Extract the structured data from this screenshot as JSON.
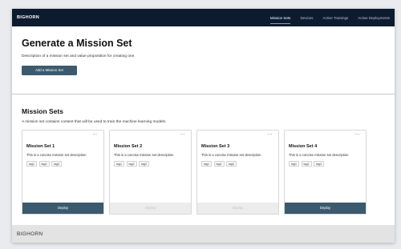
{
  "nav": {
    "brand": "BIGHORN",
    "links": [
      "Mission Sets",
      "Devices",
      "Active Trainings",
      "Active Deployments"
    ]
  },
  "hero": {
    "title": "Generate a Mission Set",
    "description": "Description of a mission set and value proposition for creating one.",
    "button_label": "Add a Mission Set"
  },
  "sets": {
    "title": "Mission Sets",
    "description": "A mission set contains content that will be used to train the machine learning models.",
    "cards": [
      {
        "title": "Mission Set 1",
        "description": "This is a concise mission set description",
        "tags": [
          "tag1",
          "tag2",
          "tag3"
        ],
        "menu": "...",
        "deploy_label": "Deploy",
        "deploy_enabled": true
      },
      {
        "title": "Mission Set 2",
        "description": "This is a concise mission set description",
        "tags": [
          "tag1",
          "tag2",
          "tag3"
        ],
        "menu": "...",
        "deploy_label": "Deploy",
        "deploy_enabled": false
      },
      {
        "title": "Mission Set 3",
        "description": "This is a concise mission set description",
        "tags": [
          "tag1",
          "tag2",
          "tag3"
        ],
        "menu": "...",
        "deploy_label": "Deploy",
        "deploy_enabled": false
      },
      {
        "title": "Mission Set 4",
        "description": "This is a concise mission set description",
        "tags": [
          "tag1",
          "tag2",
          "tag3"
        ],
        "menu": "...",
        "deploy_label": "Deploy",
        "deploy_enabled": true
      }
    ]
  },
  "footer": {
    "brand": "BIGHORN"
  },
  "colors": {
    "nav_background": "#0d1b2e",
    "primary": "#3b5a6e",
    "active_underline": "#4fb0e0",
    "disabled": "#ececec"
  }
}
